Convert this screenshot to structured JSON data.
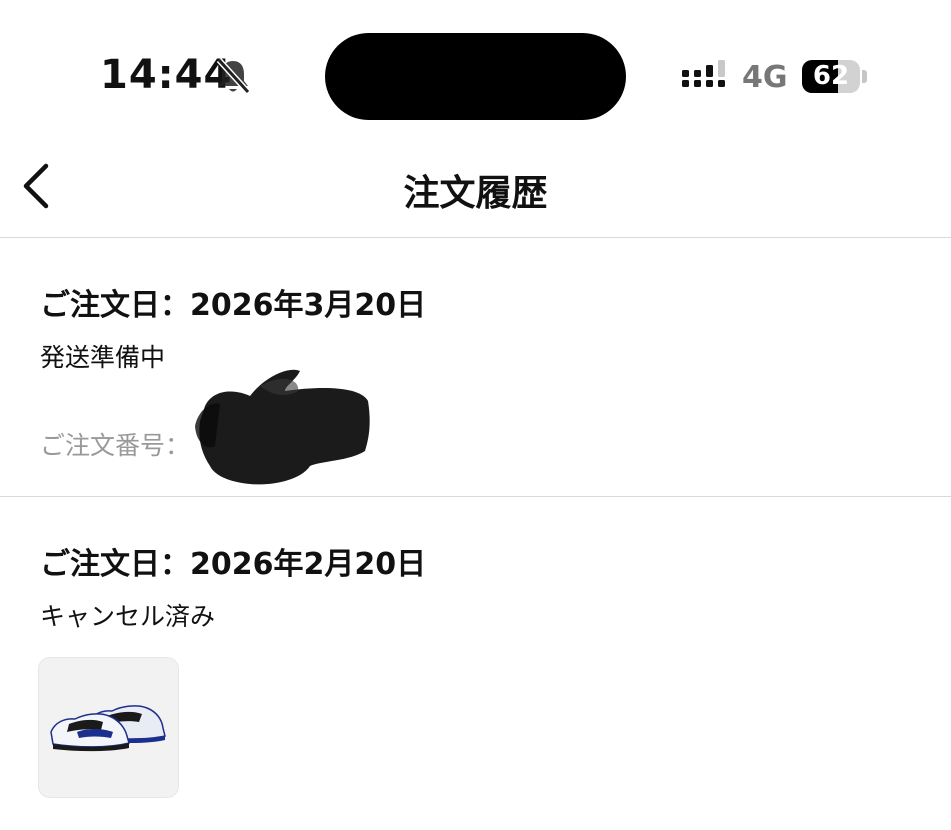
{
  "status_bar": {
    "time": "14:44",
    "network": "4G",
    "battery_percent": "62",
    "battery_level": 0.62,
    "silent_icon": "bell-slash-icon",
    "signal_icon": "signal-icon"
  },
  "header": {
    "title": "注文履歴",
    "back_icon": "chevron-left-icon"
  },
  "orders": [
    {
      "date": "ご注文日：2026年3月20日",
      "status": "発送準備中",
      "order_number_label": "ご注文番号："
    },
    {
      "date": "ご注文日：2026年2月20日",
      "status": "キャンセル済み",
      "thumbnail_icon": "sneaker-icon"
    }
  ],
  "colors": {
    "text": "#111111",
    "muted": "#999999",
    "divider": "#d9d9d9",
    "thumb_bg": "#f2f2f2",
    "shoe_accent": "#1d2f8c"
  }
}
